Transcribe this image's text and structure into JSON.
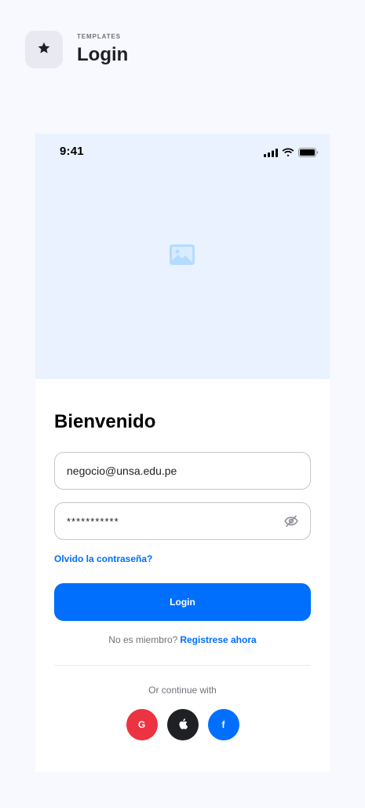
{
  "header": {
    "kicker": "TEMPLATES",
    "title": "Login",
    "icon": "star-icon"
  },
  "status_bar": {
    "time": "9:41",
    "icons": [
      "signal-icon",
      "wifi-icon",
      "battery-icon"
    ]
  },
  "hero": {
    "icon": "image-placeholder-icon"
  },
  "form": {
    "title": "Bienvenido",
    "email": {
      "value": "negocio@unsa.edu.pe",
      "placeholder": ""
    },
    "password": {
      "value": "***********",
      "placeholder": "",
      "toggle_icon": "eye-off-icon"
    },
    "forgot_password": "Olvido la contraseña?",
    "login_button": "Login",
    "register_prompt": "No es miembro?",
    "register_link": "Registrese ahora",
    "continue_text": "Or continue with"
  },
  "social": [
    {
      "name": "google",
      "label": "G",
      "icon": "google-icon",
      "color": "#ED3241"
    },
    {
      "name": "apple",
      "label": "",
      "icon": "apple-icon",
      "color": "#1F2024"
    },
    {
      "name": "facebook",
      "label": "f",
      "icon": "facebook-icon",
      "color": "#006FFD"
    }
  ],
  "colors": {
    "background": "#F7F9FE",
    "accent": "#006FFD",
    "hero": "#EAF2FF",
    "text": "#1F2024",
    "muted": "#71727A",
    "border": "#C5C6CC"
  }
}
